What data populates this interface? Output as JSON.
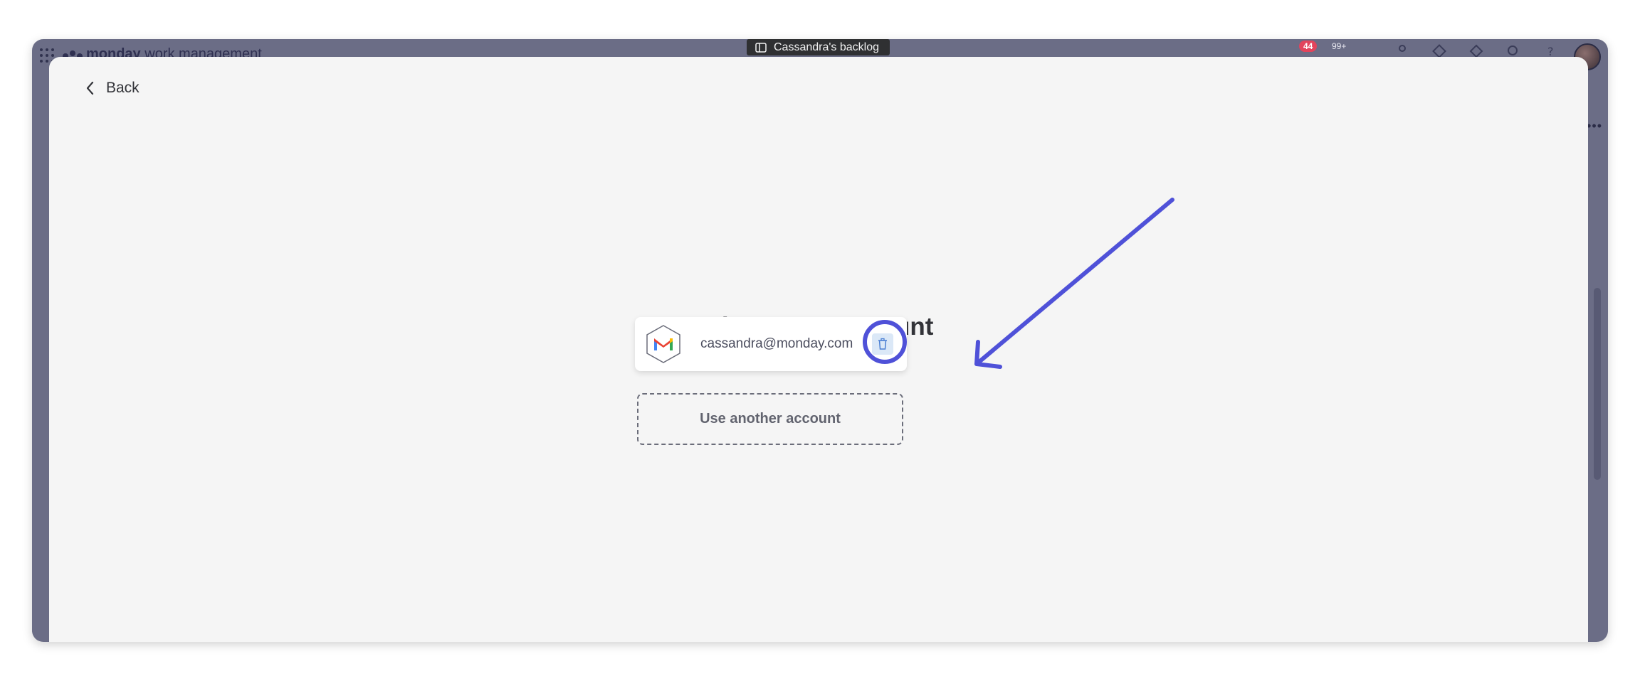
{
  "window": {
    "title": "Cassandra's backlog",
    "brand_bold": "monday",
    "brand_rest": " work management",
    "notification_count": "44",
    "updates_count": "99+"
  },
  "modal": {
    "back_label": "Back",
    "heading": "Choose an account",
    "accounts": [
      {
        "email": "cassandra@monday.com",
        "provider_icon": "gmail-icon"
      }
    ],
    "use_another_label": "Use another account"
  },
  "annotation": {
    "color": "#4f51d8",
    "target": "delete-account-button"
  },
  "colors": {
    "window_bg": "#6b6d86",
    "modal_bg": "#f5f5f5",
    "trash_bg": "#dbe8f7",
    "badge": "#e2445c"
  }
}
